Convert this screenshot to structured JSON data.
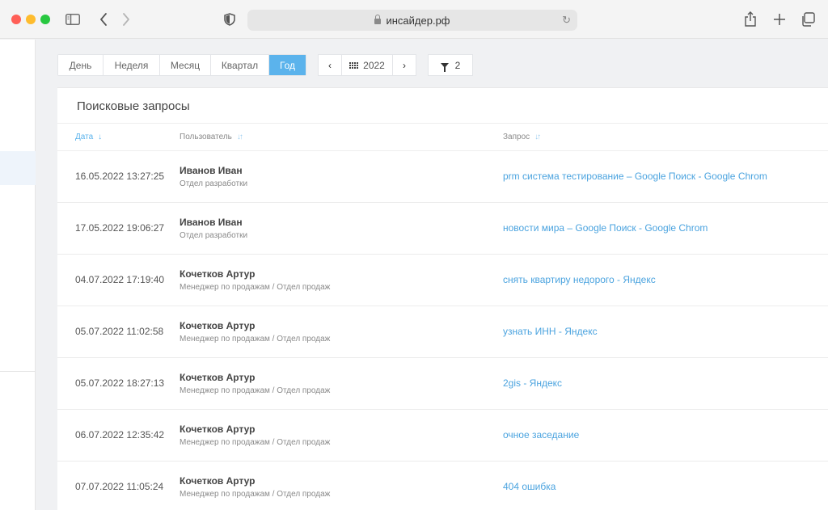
{
  "browser": {
    "address": "инсайдер.рф",
    "traffic_colors": [
      "#ff5f57",
      "#febc2e",
      "#28c840"
    ]
  },
  "filters": {
    "periods": [
      "День",
      "Неделя",
      "Месяц",
      "Квартал",
      "Год"
    ],
    "active_period": "Год",
    "year": "2022",
    "filter_count": "2",
    "accent_color": "#5bb3ec"
  },
  "table": {
    "title": "Поисковые запросы",
    "columns": [
      {
        "label": "Дата",
        "sort_icon": "↓"
      },
      {
        "label": "Пользователь",
        "sort_icon": "↓↑"
      },
      {
        "label": "Запрос",
        "sort_icon": "↓↑"
      }
    ],
    "rows": [
      {
        "date": "16.05.2022 13:27:25",
        "user": "Иванов Иван",
        "dept": "Отдел разработки",
        "query": "prm система тестирование – Google Поиск - Google Chrom"
      },
      {
        "date": "17.05.2022 19:06:27",
        "user": "Иванов Иван",
        "dept": "Отдел разработки",
        "query": "новости мира – Google Поиск - Google Chrom"
      },
      {
        "date": "04.07.2022 17:19:40",
        "user": "Кочетков Артур",
        "dept": "Менеджер по продажам / Отдел продаж",
        "query": "снять квартиру недорого - Яндекс"
      },
      {
        "date": "05.07.2022 11:02:58",
        "user": "Кочетков Артур",
        "dept": "Менеджер по продажам / Отдел продаж",
        "query": "узнать ИНН - Яндекс"
      },
      {
        "date": "05.07.2022 18:27:13",
        "user": "Кочетков Артур",
        "dept": "Менеджер по продажам / Отдел продаж",
        "query": "2gis - Яндекс"
      },
      {
        "date": "06.07.2022 12:35:42",
        "user": "Кочетков Артур",
        "dept": "Менеджер по продажам / Отдел продаж",
        "query": "очное заседание"
      },
      {
        "date": "07.07.2022 11:05:24",
        "user": "Кочетков Артур",
        "dept": "Менеджер по продажам / Отдел продаж",
        "query": "404 ошибка"
      }
    ]
  }
}
